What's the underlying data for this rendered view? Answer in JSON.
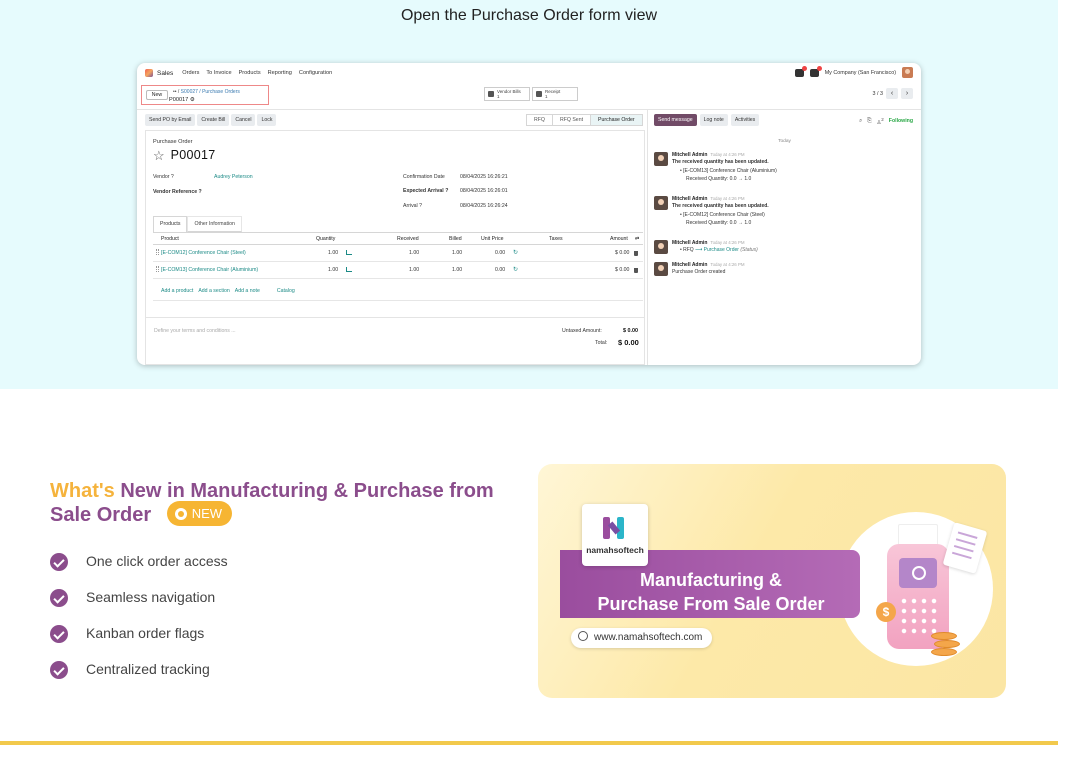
{
  "caption": "Open the Purchase Order form view",
  "odoo": {
    "app_name": "Sales",
    "menu": [
      "Orders",
      "To Invoice",
      "Products",
      "Reporting",
      "Configuration"
    ],
    "company": "My Company (San Francisco)",
    "new_label": "New",
    "breadcrumb": "S00027 / Purchase Orders",
    "current_record": "P00017",
    "smart_buttons": [
      {
        "label": "Vendor Bills",
        "count": "1"
      },
      {
        "label": "Receipt",
        "count": "1"
      }
    ],
    "pager": "3 / 3",
    "actions": [
      "Send PO by Email",
      "Create Bill",
      "Cancel",
      "Lock"
    ],
    "status_steps": [
      "RFQ",
      "RFQ Sent",
      "Purchase Order"
    ],
    "form": {
      "caption": "Purchase Order",
      "title": "P00017",
      "vendor_label": "Vendor ?",
      "vendor_value": "Audrey Peterson",
      "vendor_ref_label": "Vendor Reference ?",
      "confirmation_label": "Confirmation Date",
      "confirmation_value": "08/04/2025 16:26:21",
      "expected_label": "Expected Arrival ?",
      "expected_value": "08/04/2025 16:26:01",
      "arrival_label": "Arrival ?",
      "arrival_value": "08/04/2025 16:26:24"
    },
    "tabs": [
      "Products",
      "Other Information"
    ],
    "table": {
      "headers": [
        "Product",
        "Quantity",
        "Received",
        "Billed",
        "Unit Price",
        "Taxes",
        "Amount"
      ],
      "rows": [
        {
          "product": "[E-COM12] Conference Chair (Steel)",
          "quantity": "1.00",
          "received": "1.00",
          "billed": "1.00",
          "unit_price": "0.00",
          "amount": "$ 0.00"
        },
        {
          "product": "[E-COM13] Conference Chair (Aluminium)",
          "quantity": "1.00",
          "received": "1.00",
          "billed": "1.00",
          "unit_price": "0.00",
          "amount": "$ 0.00"
        }
      ]
    },
    "add_links": [
      "Add a product",
      "Add a section",
      "Add a note",
      "Catalog"
    ],
    "terms_placeholder": "Define your terms and conditions ...",
    "untaxed_label": "Untaxed Amount:",
    "untaxed_value": "$ 0.00",
    "total_label": "Total:",
    "total_value": "$ 0.00",
    "chatter": {
      "buttons": [
        "Send message",
        "Log note",
        "Activities"
      ],
      "followers_count": "2",
      "following_label": "Following",
      "today_label": "Today",
      "messages": [
        {
          "author": "Mitchell Admin",
          "time": "Today at 4:26 PM",
          "lines": [
            "The received quantity has been updated.",
            "• [E-COM13] Conference Chair (Aluminium)",
            "Received Quantity: 0.0 → 1.0"
          ]
        },
        {
          "author": "Mitchell Admin",
          "time": "Today at 4:26 PM",
          "lines": [
            "The received quantity has been updated.",
            "• [E-COM12] Conference Chair (Steel)",
            "Received Quantity: 0.0 → 1.0"
          ]
        },
        {
          "author": "Mitchell Admin",
          "time": "Today at 4:26 PM",
          "status_from": "RFQ",
          "status_to": "Purchase Order",
          "status_note": "(Status)"
        },
        {
          "author": "Mitchell Admin",
          "time": "Today at 4:26 PM",
          "lines": [
            "Purchase Order created"
          ]
        }
      ]
    }
  },
  "promo": {
    "heading_highlight": "What's",
    "heading_rest": "New in Manufacturing & Purchase from Sale Order",
    "badge": "NEW",
    "features": [
      "One click order access",
      "Seamless navigation",
      "Kanban order flags",
      "Centralized tracking"
    ],
    "banner": {
      "brand": "namahsoftech",
      "title_line1": "Manufacturing &",
      "title_line2": "Purchase From Sale Order",
      "url": "www.namahsoftech.com"
    }
  },
  "colors": {
    "accent_purple": "#8b4d8c",
    "accent_yellow": "#f5b33c",
    "odoo_primary": "#714b67",
    "link_teal": "#1b8a86",
    "top_bg": "#e6fbfd"
  }
}
